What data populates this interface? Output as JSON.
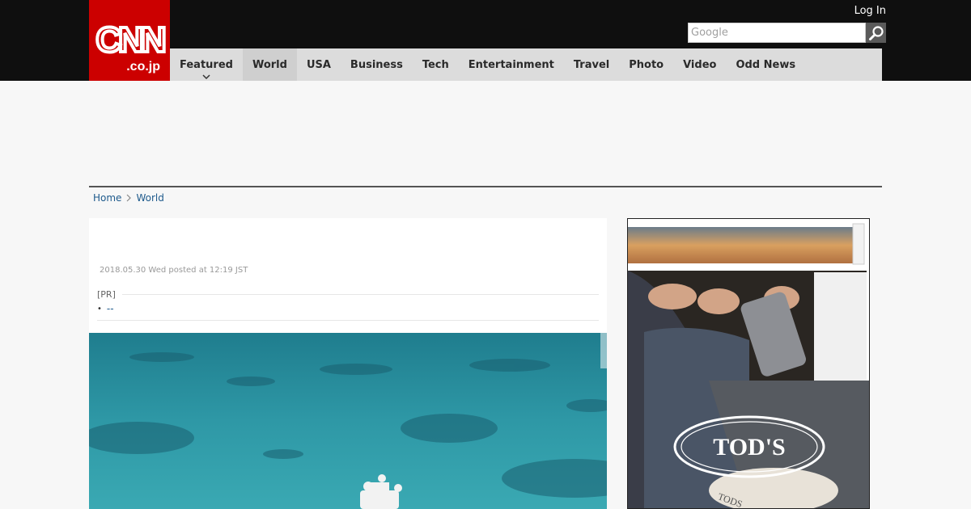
{
  "header": {
    "logo_text": "CNN",
    "logo_sub": ".co.jp",
    "login_label": "Log In",
    "search": {
      "placeholder": "Google"
    }
  },
  "nav": {
    "items": [
      {
        "label": "Featured"
      },
      {
        "label": "World"
      },
      {
        "label": "USA"
      },
      {
        "label": "Business"
      },
      {
        "label": "Tech"
      },
      {
        "label": "Entertainment"
      },
      {
        "label": "Travel"
      },
      {
        "label": "Photo"
      },
      {
        "label": "Video"
      },
      {
        "label": "Odd News"
      }
    ],
    "active_index": 1
  },
  "breadcrumb": {
    "home": "Home",
    "section": "World"
  },
  "article": {
    "posted": "2018.05.30 Wed posted at 12:19 JST",
    "pr_label": "[PR]",
    "pr_link": "--"
  },
  "side_ad": {
    "brand": "TOD'S",
    "shoe_label": "TODS"
  },
  "colors": {
    "brand_red": "#cc0000",
    "topbar": "#0f0f0f",
    "nav_bg": "#dcdcdc",
    "link": "#1e5a8c",
    "sea": "#2f8f9c"
  }
}
